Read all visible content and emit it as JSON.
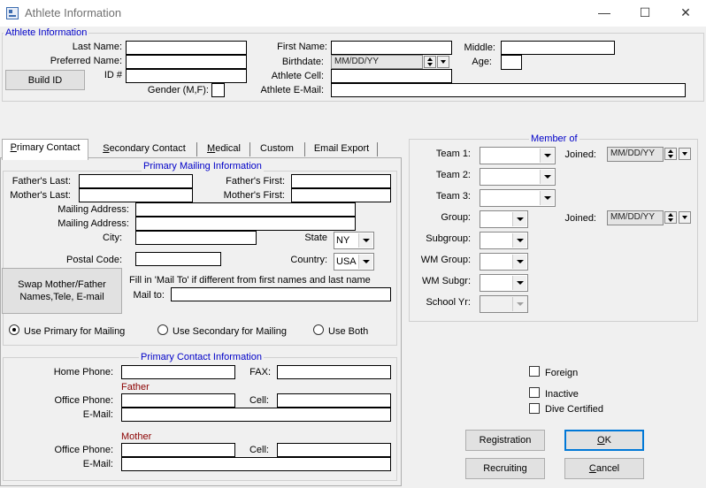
{
  "window": {
    "title": "Athlete Information",
    "controls": {
      "minimize": "—",
      "maximize": "☐",
      "close": "✕"
    }
  },
  "athlete_info": {
    "legend": "Athlete Information",
    "last_name_label": "Last Name:",
    "preferred_name_label": "Preferred Name:",
    "id_label": "ID #",
    "gender_label": "Gender (M,F):",
    "first_name_label": "First Name:",
    "birthdate_label": "Birthdate:",
    "birthdate_value": "MM/DD/YY",
    "athlete_cell_label": "Athlete Cell:",
    "athlete_email_label": "Athlete E-Mail:",
    "middle_label": "Middle:",
    "age_label": "Age:",
    "build_id_button": "Build ID"
  },
  "tabs": [
    {
      "pre": "",
      "accel": "P",
      "post": "rimary Contact"
    },
    {
      "pre": "",
      "accel": "S",
      "post": "econdary Contact"
    },
    {
      "pre": "",
      "accel": "M",
      "post": "edical"
    },
    {
      "pre": "Custom",
      "accel": "",
      "post": ""
    },
    {
      "pre": "Email Export",
      "accel": "",
      "post": ""
    }
  ],
  "mailing": {
    "legend": "Primary Mailing Information",
    "fathers_last_label": "Father's Last:",
    "mothers_last_label": "Mother's Last:",
    "fathers_first_label": "Father's First:",
    "mothers_first_label": "Mother's First:",
    "mailing_address_label_1": "Mailing Address:",
    "mailing_address_label_2": "Mailing Address:",
    "city_label": "City:",
    "state_label": "State",
    "state_value": "NY",
    "postal_code_label": "Postal Code:",
    "country_label": "Country:",
    "country_value": "USA",
    "swap_button": "Swap Mother/Father Names,Tele, E-mail",
    "mail_to_hint": "Fill in 'Mail To' if different from first names and last name",
    "mail_to_label": "Mail to:",
    "radio_primary": "Use Primary for Mailing",
    "radio_secondary": "Use Secondary for Mailing",
    "radio_both": "Use Both"
  },
  "contact": {
    "legend": "Primary Contact Information",
    "home_phone_label": "Home Phone:",
    "fax_label": "FAX:",
    "father_heading": "Father",
    "father_office_label": "Office Phone:",
    "father_cell_label": "Cell:",
    "father_email_label": "E-Mail:",
    "mother_heading": "Mother",
    "mother_office_label": "Office Phone:",
    "mother_cell_label": "Cell:",
    "mother_email_label": "E-Mail:"
  },
  "member_of": {
    "legend": "Member of",
    "team1_label": "Team 1:",
    "team2_label": "Team 2:",
    "team3_label": "Team 3:",
    "group_label": "Group:",
    "subgroup_label": "Subgroup:",
    "wm_group_label": "WM Group:",
    "wm_subgr_label": "WM Subgr:",
    "school_yr_label": "School Yr:",
    "joined_label_1": "Joined:",
    "joined_value_1": "MM/DD/YY",
    "joined_label_2": "Joined:",
    "joined_value_2": "MM/DD/YY"
  },
  "flags": {
    "foreign": "Foreign",
    "inactive": "Inactive",
    "dive_certified": "Dive Certified"
  },
  "buttons": {
    "registration": "Registration",
    "ok_accel": "O",
    "ok_rest": "K",
    "recruiting": "Recruiting",
    "cancel_accel": "C",
    "cancel_rest": "ancel"
  },
  "colors": {
    "accent_legend": "#0000c8",
    "window_bg": "#f0f0f0",
    "focus_border": "#0078d7"
  }
}
